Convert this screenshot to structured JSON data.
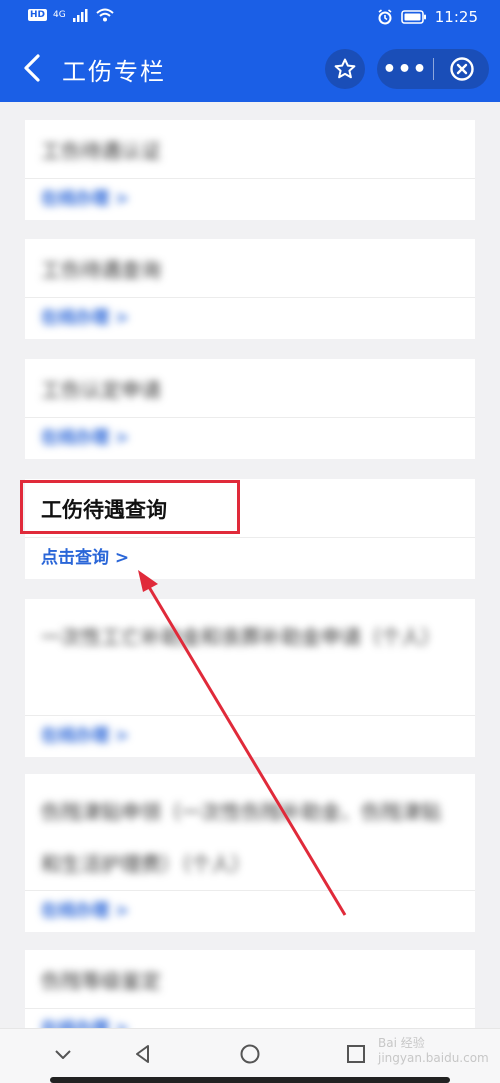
{
  "status_bar": {
    "network_label": "HD",
    "signal_label": "4G",
    "time": "11:25"
  },
  "nav": {
    "title": "工伤专栏",
    "back_icon": "chevron-left-icon",
    "favorite_icon": "star-icon",
    "more_label": "•••",
    "close_icon": "close-circle-icon"
  },
  "cards": [
    {
      "title": "工伤待遇认证",
      "link": "在线办理 >",
      "blurred": true
    },
    {
      "title": "工伤待遇查询",
      "link": "在线办理 >",
      "blurred": true
    },
    {
      "title": "工伤认定申请",
      "link": "在线办理 >",
      "blurred": true
    },
    {
      "title": "工伤待遇查询",
      "link": "点击查询 >",
      "blurred": false
    },
    {
      "title": "一次性工亡补助金和丧葬补助金申请（个人）",
      "link": "在线办理 >",
      "blurred": true
    },
    {
      "title": "伤残津贴申领（一次性伤残补助金、伤残津贴和生活护理费）（个人）",
      "link": "在线办理 >",
      "blurred": true
    },
    {
      "title": "伤残等级鉴定",
      "link": "在线办理 >",
      "blurred": true
    }
  ],
  "annotation": {
    "highlight_color": "#e02a3a"
  },
  "bottom_nav": {
    "items": [
      "chevron-down-icon",
      "back-triangle-icon",
      "home-circle-icon",
      "recents-square-icon"
    ]
  },
  "watermark": "Bai 经验 jingyan.baidu.com",
  "colors": {
    "brand_blue": "#1b5fe6",
    "link_blue": "#2a66d8",
    "background": "#f1f1f3"
  }
}
